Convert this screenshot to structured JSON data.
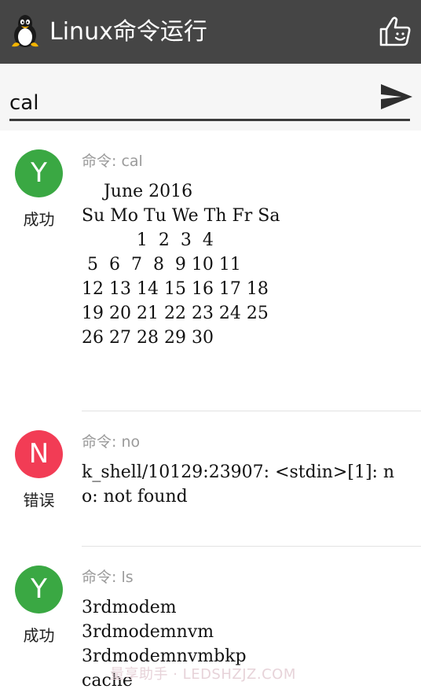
{
  "app": {
    "title": "Linux命令运行",
    "toolbar_bg": "#454545",
    "icons": {
      "logo": "tux-penguin-icon",
      "like": "thumbs-up-icon",
      "send": "send-icon"
    }
  },
  "input": {
    "value": "cal",
    "placeholder": ""
  },
  "results": [
    {
      "avatar_letter": "Y",
      "avatar_color": "#3aa843",
      "status": "成功",
      "command_label": "命令: cal",
      "output": "    June 2016\nSu Mo Tu We Th Fr Sa\n          1  2  3  4\n 5  6  7  8  9 10 11\n12 13 14 15 16 17 18\n19 20 21 22 23 24 25\n26 27 28 29 30"
    },
    {
      "avatar_letter": "N",
      "avatar_color": "#f23c55",
      "status": "错误",
      "command_label": "命令: no",
      "output": "k_shell/10129:23907: <stdin>[1]: no: not found"
    },
    {
      "avatar_letter": "Y",
      "avatar_color": "#3aa843",
      "status": "成功",
      "command_label": "命令: ls",
      "output": "3rdmodem\n3rdmodemnvm\n3rdmodemnvmbkp\ncache"
    }
  ],
  "watermark": "量享助手 · LEDSHZJZ.COM"
}
